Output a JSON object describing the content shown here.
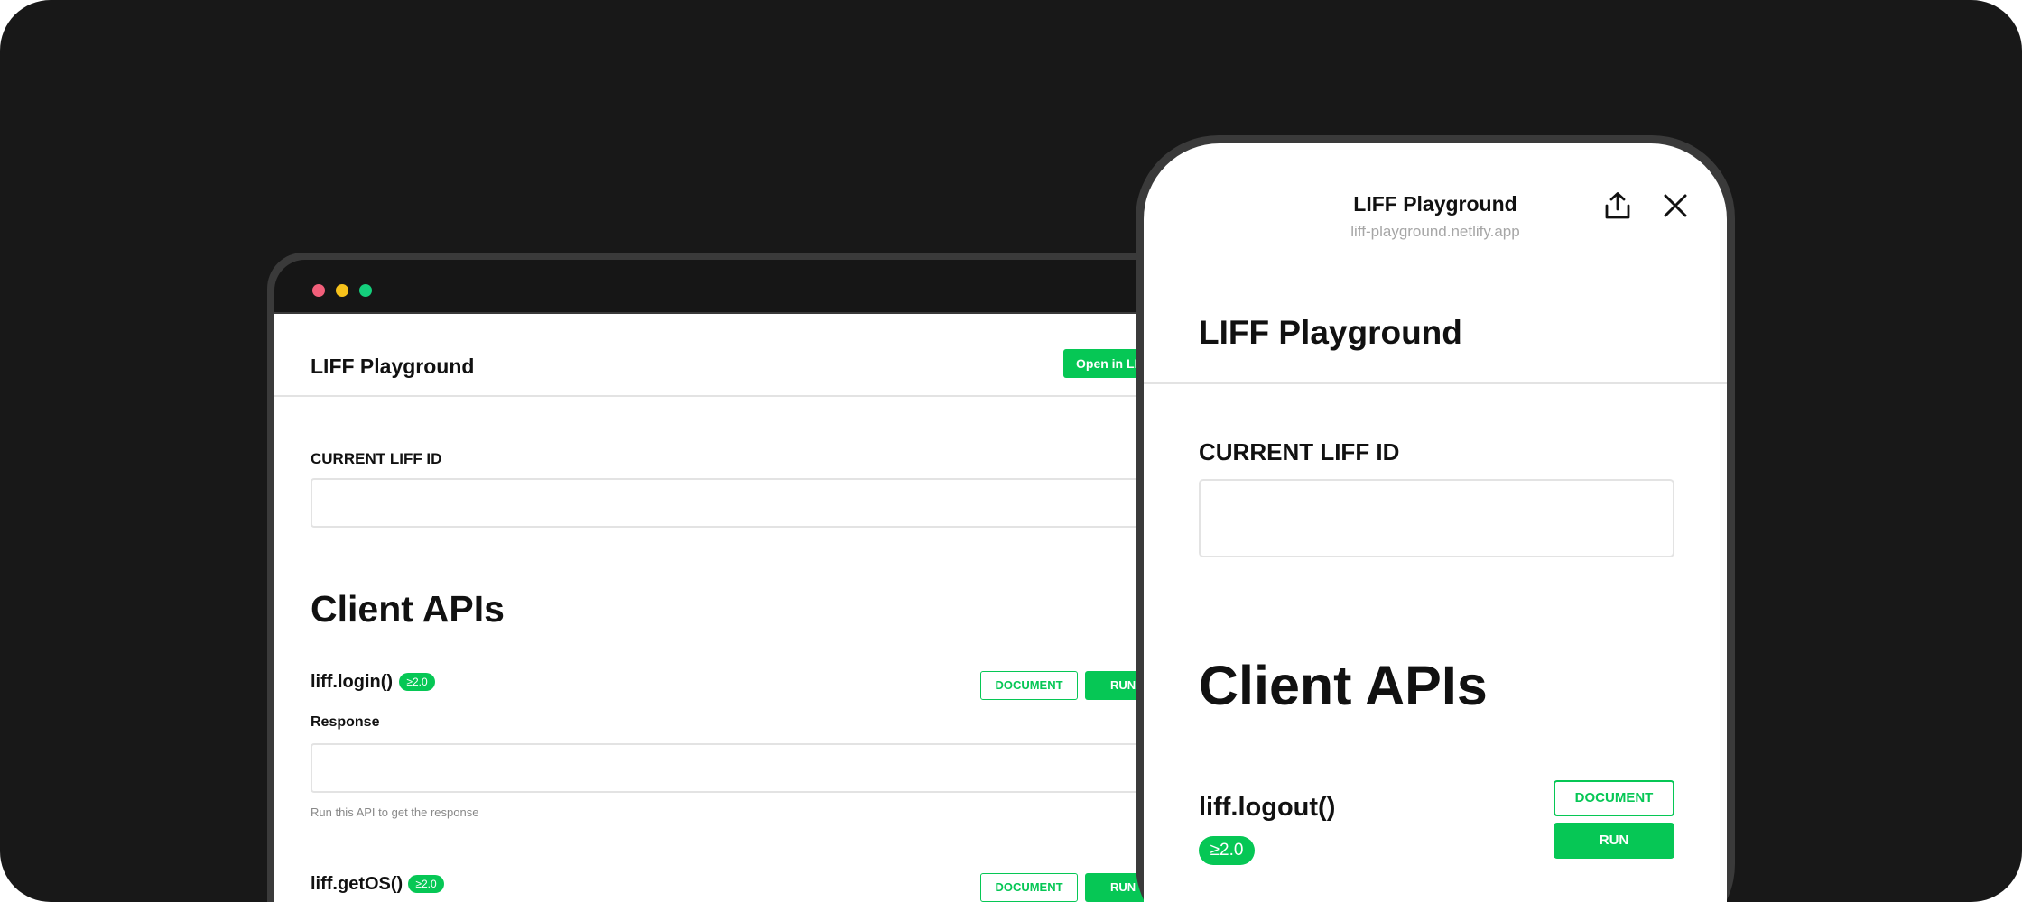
{
  "desktop": {
    "header": {
      "title": "LIFF Playground",
      "open_button": "Open in LINE"
    },
    "liff_id": {
      "label": "CURRENT LIFF ID",
      "value": ""
    },
    "section_title": "Client APIs",
    "apis": [
      {
        "name": "liff.login()",
        "badge": "≥2.0",
        "document_label": "DOCUMENT",
        "run_label": "RUN",
        "response_label": "Response",
        "hint": "Run this API to get the response"
      },
      {
        "name": "liff.getOS()",
        "badge": "≥2.0",
        "document_label": "DOCUMENT",
        "run_label": "RUN"
      }
    ]
  },
  "phone": {
    "header": {
      "title": "LIFF Playground",
      "url": "liff-playground.netlify.app"
    },
    "page_title": "LIFF Playground",
    "liff_id": {
      "label": "CURRENT LIFF ID",
      "value": ""
    },
    "section_title": "Client APIs",
    "api": {
      "name": "liff.logout()",
      "badge": "≥2.0",
      "document_label": "DOCUMENT",
      "run_label": "RUN"
    }
  },
  "colors": {
    "accent": "#06c755",
    "background": "#181818",
    "frame": "#3a3a3a"
  },
  "icons": {
    "share": "share-icon",
    "close": "close-icon"
  }
}
